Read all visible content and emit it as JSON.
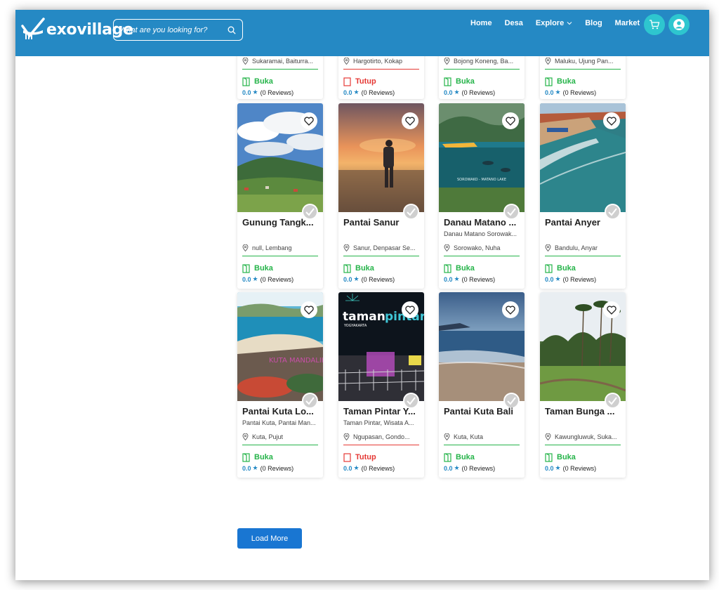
{
  "brand": {
    "name": "exovillage"
  },
  "search": {
    "placeholder": "What are you looking for?"
  },
  "nav": {
    "home": "Home",
    "desa": "Desa",
    "explore": "Explore",
    "blog": "Blog",
    "market": "Market"
  },
  "icons": {
    "cart": "cart-icon",
    "user": "user-icon",
    "heart": "heart-icon",
    "verified": "verified-check-icon",
    "pin": "location-pin-icon",
    "door": "door-icon"
  },
  "colors": {
    "navbar": "#2589c4",
    "accent_circle": "#2ec6cf",
    "open": "#26b44a",
    "closed": "#e53935",
    "button": "#1976d2"
  },
  "top_row": [
    {
      "location": "Sukaramai, Baiturra...",
      "status": "Buka",
      "score": "0.0",
      "reviews": "(0 Reviews)"
    },
    {
      "location": "Hargotirto, Kokap",
      "status": "Tutup",
      "score": "0.0",
      "reviews": "(0 Reviews)"
    },
    {
      "location": "Bojong Koneng, Ba...",
      "status": "Buka",
      "score": "0.0",
      "reviews": "(0 Reviews)"
    },
    {
      "location": "Maluku, Ujung Pan...",
      "status": "Buka",
      "score": "0.0",
      "reviews": "(0 Reviews)"
    }
  ],
  "cards": [
    {
      "title": "Gunung Tangk...",
      "subtitle": "",
      "location": "null, Lembang",
      "status": "Buka",
      "score": "0.0",
      "reviews": "(0 Reviews)"
    },
    {
      "title": "Pantai Sanur",
      "subtitle": "",
      "location": "Sanur, Denpasar Se...",
      "status": "Buka",
      "score": "0.0",
      "reviews": "(0 Reviews)"
    },
    {
      "title": "Danau Matano ...",
      "subtitle": "Danau Matano Sorowak...",
      "location": "Sorowako, Nuha",
      "status": "Buka",
      "score": "0.0",
      "reviews": "(0 Reviews)"
    },
    {
      "title": "Pantai Anyer",
      "subtitle": "",
      "location": "Bandulu, Anyar",
      "status": "Buka",
      "score": "0.0",
      "reviews": "(0 Reviews)"
    },
    {
      "title": "Pantai Kuta Lo...",
      "subtitle": "Pantai Kuta, Pantai Man...",
      "location": "Kuta, Pujut",
      "status": "Buka",
      "score": "0.0",
      "reviews": "(0 Reviews)"
    },
    {
      "title": "Taman Pintar Y...",
      "subtitle": "Taman Pintar, Wisata A...",
      "location": "Ngupasan, Gondo...",
      "status": "Tutup",
      "score": "0.0",
      "reviews": "(0 Reviews)"
    },
    {
      "title": "Pantai Kuta Bali",
      "subtitle": "",
      "location": "Kuta, Kuta",
      "status": "Buka",
      "score": "0.0",
      "reviews": "(0 Reviews)"
    },
    {
      "title": "Taman Bunga ...",
      "subtitle": "",
      "location": "Kawungluwuk, Suka...",
      "status": "Buka",
      "score": "0.0",
      "reviews": "(0 Reviews)"
    }
  ],
  "image_text": {
    "danau": "SOROWAKO - MATANO LAKE",
    "kuta_lombok": "KUTA MANDALIKA",
    "taman_pintar_1": "taman",
    "taman_pintar_2": "pintar",
    "taman_pintar_3": "YOGYAKARTA"
  },
  "load_more": "Load More"
}
